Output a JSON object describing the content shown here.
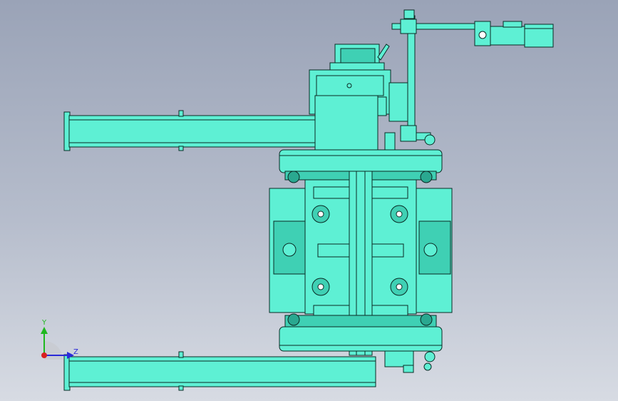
{
  "viewport": {
    "background_top": "#9aa3b7",
    "background_bottom": "#d7dbe3"
  },
  "colors": {
    "part_fill": "#5ef0d4",
    "part_shade": "#3fd0b4",
    "part_dark": "#2aa890",
    "edge": "#0a2a24"
  },
  "triad": {
    "y_label": "Y",
    "z_label": "Z",
    "y_color": "#1fb81f",
    "z_color": "#2a2ad8",
    "origin_color": "#d81f1f"
  }
}
